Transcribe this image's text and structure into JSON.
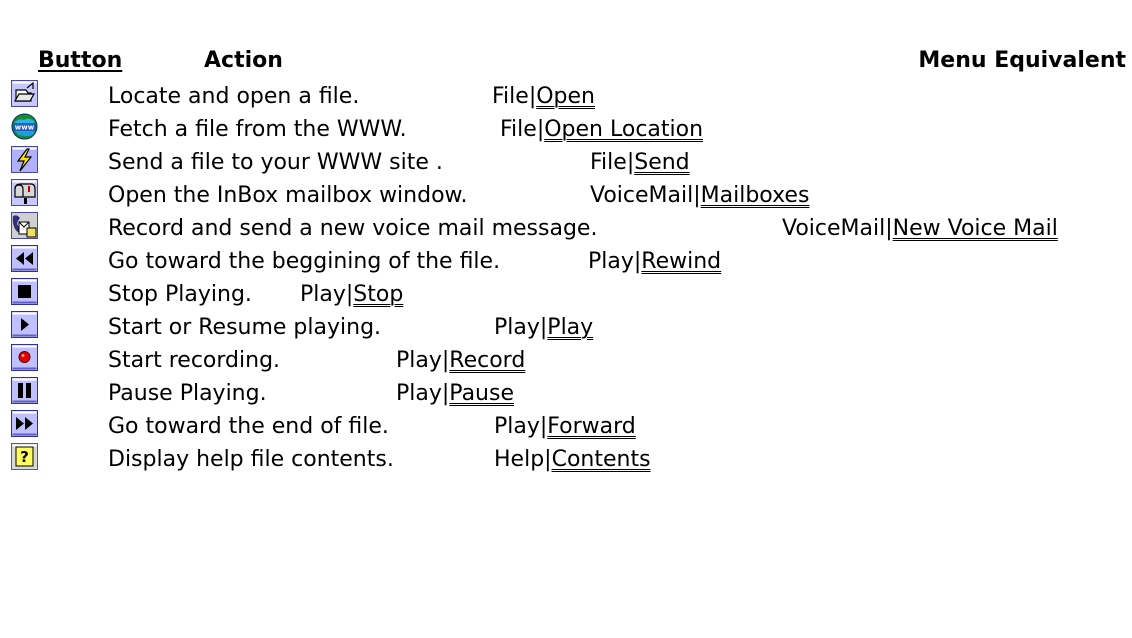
{
  "header": {
    "button": "Button",
    "action": "Action",
    "menu": "Menu Equivalent"
  },
  "rows": [
    {
      "icon": "open-file-icon",
      "action": "Locate and open a file.",
      "menu_prefix": "File|",
      "menu_cmd": "Open"
    },
    {
      "icon": "www-globe-icon",
      "action": "Fetch a file from the WWW.",
      "menu_prefix": "File|",
      "menu_cmd": "Open Location"
    },
    {
      "icon": "send-bolt-icon",
      "action": "Send a file to your WWW site .",
      "menu_prefix": "File|",
      "menu_cmd": "Send"
    },
    {
      "icon": "mailbox-icon",
      "action": "Open the InBox mailbox window.",
      "menu_prefix": "VoiceMail|",
      "menu_cmd": "Mailboxes"
    },
    {
      "icon": "new-voicemail-icon",
      "action": "Record and send a new voice mail message.",
      "menu_prefix": "VoiceMail|",
      "menu_cmd": "New Voice Mail"
    },
    {
      "icon": "rewind-icon",
      "action": "Go toward the beggining of the file.",
      "menu_prefix": "Play|",
      "menu_cmd": "Rewind"
    },
    {
      "icon": "stop-icon",
      "action": "Stop Playing.",
      "menu_prefix": "Play|",
      "menu_cmd": "Stop"
    },
    {
      "icon": "play-icon",
      "action": "Start or Resume playing.",
      "menu_prefix": "Play|",
      "menu_cmd": "Play"
    },
    {
      "icon": "record-icon",
      "action": "Start recording.",
      "menu_prefix": "Play|",
      "menu_cmd": "Record"
    },
    {
      "icon": "pause-icon",
      "action": "Pause Playing.",
      "menu_prefix": "Play|",
      "menu_cmd": "Pause"
    },
    {
      "icon": "fast-forward-icon",
      "action": "Go toward the end of file.",
      "menu_prefix": "Play|",
      "menu_cmd": "Forward"
    },
    {
      "icon": "help-icon",
      "action": "Display help file contents.",
      "menu_prefix": "Help|",
      "menu_cmd": "Contents"
    }
  ]
}
